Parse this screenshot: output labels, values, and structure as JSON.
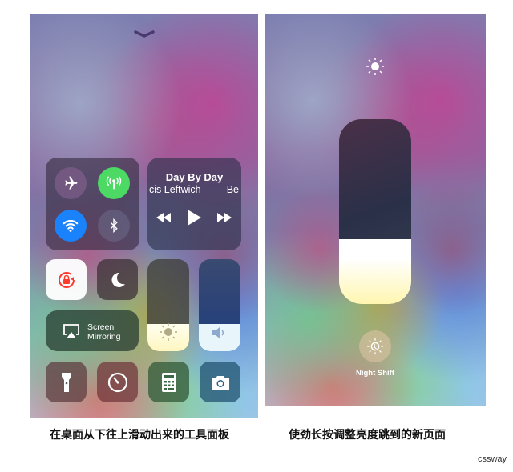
{
  "left_panel": {
    "grabber_icon": "chevron-down-icon",
    "connectivity": {
      "airplane": {
        "icon": "airplane-icon",
        "active": false
      },
      "cellular": {
        "icon": "cellular-antenna-icon",
        "active": true,
        "color": "#4cd964"
      },
      "wifi": {
        "icon": "wifi-icon",
        "active": true,
        "color": "#1a82fb"
      },
      "bluetooth": {
        "icon": "bluetooth-icon",
        "active": false
      }
    },
    "music": {
      "title": "Day By Day",
      "artist_scroll": "cis Leftwich",
      "artist_scroll_next": "Be",
      "controls": [
        "rewind-icon",
        "play-icon",
        "fast-forward-icon"
      ]
    },
    "orientation_lock": {
      "icon": "rotation-lock-icon",
      "active": true,
      "color": "#ff3b30"
    },
    "do_not_disturb": {
      "icon": "moon-icon",
      "active": false
    },
    "screen_mirroring": {
      "line1": "Screen",
      "line2": "Mirroring",
      "icon": "airplay-icon"
    },
    "brightness": {
      "icon": "sun-icon",
      "level": 0.3
    },
    "volume": {
      "icon": "speaker-icon",
      "level": 0.3
    },
    "bottom_row": [
      "flashlight-icon",
      "timer-icon",
      "calculator-icon",
      "camera-icon"
    ]
  },
  "right_panel": {
    "top_icon": "sun-icon",
    "brightness_level": 0.35,
    "night_shift": {
      "label": "Night Shift",
      "icon": "night-shift-icon"
    }
  },
  "captions": {
    "left": "在桌面从下往上滑动出来的工具面板",
    "right": "使劲长按调整亮度跳到的新页面"
  },
  "watermark": "cssway"
}
